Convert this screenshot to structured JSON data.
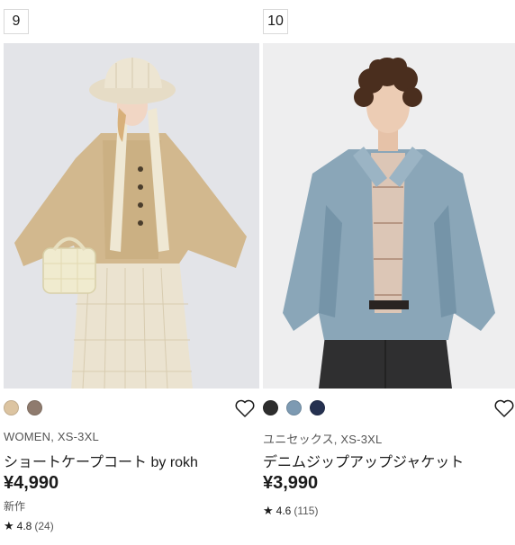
{
  "products": [
    {
      "rank": "9",
      "swatches": [
        "#dcc4a1",
        "#8f7b6e"
      ],
      "meta": "WOMEN, XS-3XL",
      "name": "ショートケープコート by rokh",
      "price": "¥4,990",
      "flag": "新作",
      "rating_star": "★",
      "rating": "4.8",
      "reviews": "(24)",
      "favorite_icon": "heart-outline-icon"
    },
    {
      "rank": "10",
      "swatches": [
        "#2d2d2d",
        "#7d9ab2",
        "#253150"
      ],
      "meta": "ユニセックス, XS-3XL",
      "name": "デニムジップアップジャケット",
      "price": "¥3,990",
      "rating_star": "★",
      "rating": "4.6",
      "reviews": "(115)",
      "favorite_icon": "heart-outline-icon"
    }
  ]
}
